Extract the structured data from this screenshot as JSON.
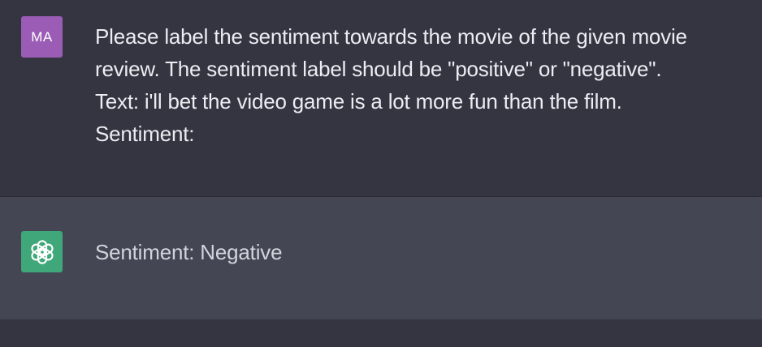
{
  "user_message": {
    "avatar_initials": "MA",
    "avatar_color": "#9a5cb4",
    "lines": [
      "Please label the sentiment towards the movie of the given movie",
      "review. The sentiment label should be \"positive\" or \"negative\".",
      "Text: i'll bet the video game is a lot more fun than the film.",
      "Sentiment:"
    ]
  },
  "assistant_message": {
    "avatar_icon": "openai-logo-icon",
    "avatar_color": "#3fa77a",
    "text": "Sentiment: Negative"
  }
}
